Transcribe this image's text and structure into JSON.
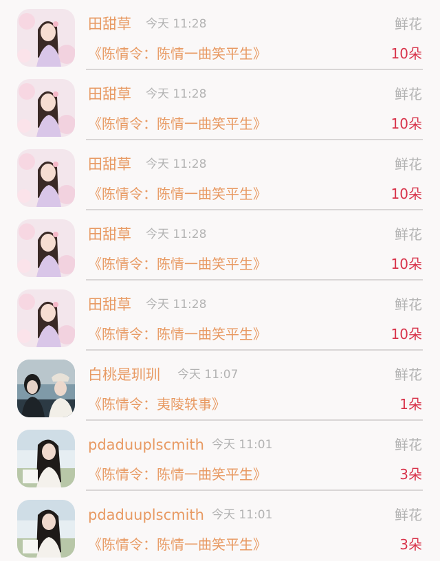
{
  "gift_records": [
    {
      "username": "田甜草",
      "time": "今天 11:28",
      "gift_type": "鲜花",
      "book_title": "《陈情令：陈情一曲笑平生》",
      "count": "10朵",
      "avatar": "girl-flowers-avatar"
    },
    {
      "username": "田甜草",
      "time": "今天 11:28",
      "gift_type": "鲜花",
      "book_title": "《陈情令：陈情一曲笑平生》",
      "count": "10朵",
      "avatar": "girl-flowers-avatar"
    },
    {
      "username": "田甜草",
      "time": "今天 11:28",
      "gift_type": "鲜花",
      "book_title": "《陈情令：陈情一曲笑平生》",
      "count": "10朵",
      "avatar": "girl-flowers-avatar"
    },
    {
      "username": "田甜草",
      "time": "今天 11:28",
      "gift_type": "鲜花",
      "book_title": "《陈情令：陈情一曲笑平生》",
      "count": "10朵",
      "avatar": "girl-flowers-avatar"
    },
    {
      "username": "田甜草",
      "time": "今天 11:28",
      "gift_type": "鲜花",
      "book_title": "《陈情令：陈情一曲笑平生》",
      "count": "10朵",
      "avatar": "girl-flowers-avatar"
    },
    {
      "username": "白桃是玔玔",
      "time": "今天 11:07",
      "gift_type": "鲜花",
      "book_title": "《陈情令：夷陵轶事》",
      "count": "1朵",
      "avatar": "two-men-avatar"
    },
    {
      "username": "pdaduuplscmith",
      "time": "今天 11:01",
      "gift_type": "鲜花",
      "book_title": "《陈情令：陈情一曲笑平生》",
      "count": "3朵",
      "avatar": "woman-portrait-avatar"
    },
    {
      "username": "pdaduuplscmith",
      "time": "今天 11:01",
      "gift_type": "鲜花",
      "book_title": "《陈情令：陈情一曲笑平生》",
      "count": "3朵",
      "avatar": "woman-portrait-avatar"
    }
  ],
  "colors": {
    "username": "#e89a63",
    "time": "#b3b3b3",
    "count": "#d8334a",
    "divider": "#d9d6d6",
    "background": "#faf8f8"
  }
}
